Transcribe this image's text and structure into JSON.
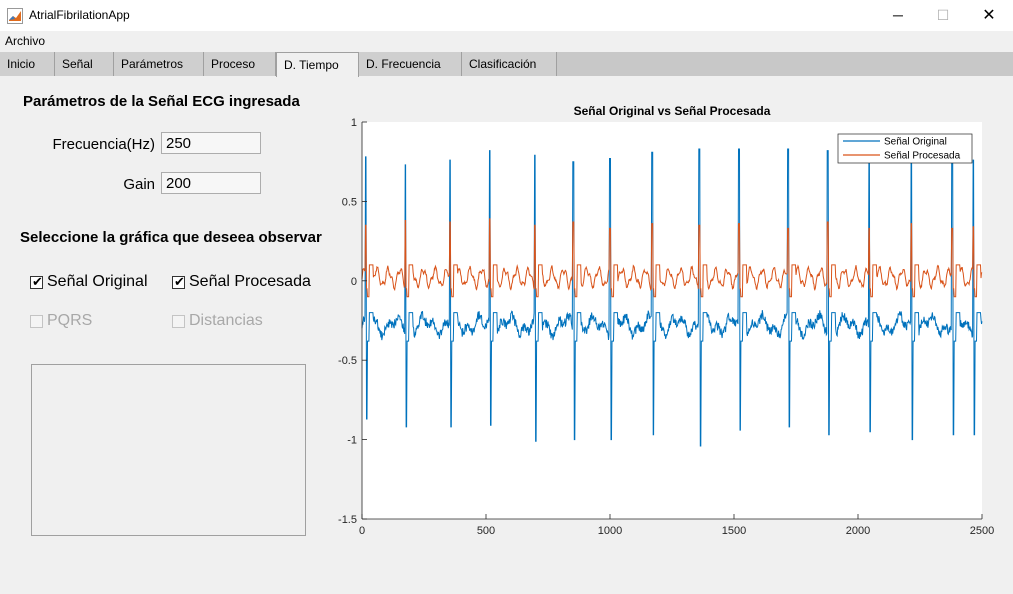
{
  "window": {
    "title": "AtrialFibrilationApp",
    "minimize_glyph": "─",
    "maximize_glyph": "☐",
    "close_glyph": "✕"
  },
  "menubar": {
    "archivo": "Archivo"
  },
  "tabs": [
    {
      "label": "Inicio",
      "active": false
    },
    {
      "label": "Señal",
      "active": false
    },
    {
      "label": "Parámetros",
      "active": false
    },
    {
      "label": "Proceso",
      "active": false
    },
    {
      "label": "D. Tiempo",
      "active": true
    },
    {
      "label": "D. Frecuencia",
      "active": false
    },
    {
      "label": "Clasificación",
      "active": false
    }
  ],
  "params": {
    "heading": "Parámetros de la Señal ECG ingresada",
    "freq_label": "Frecuencia(Hz)",
    "freq_value": "250",
    "gain_label": "Gain",
    "gain_value": "200"
  },
  "select": {
    "heading": "Seleccione la gráfica que deseea observar",
    "original_label": "Señal Original",
    "original_checked": true,
    "procesada_label": "Señal Procesada",
    "procesada_checked": true,
    "pqrs_label": "PQRS",
    "pqrs_enabled": false,
    "distancias_label": "Distancias",
    "distancias_enabled": false,
    "check_glyph": "✔"
  },
  "chart_data": {
    "type": "line",
    "title": "Señal Original vs Señal Procesada",
    "xlabel": "",
    "ylabel": "",
    "xlim": [
      0,
      2500
    ],
    "ylim": [
      -1.5,
      1
    ],
    "xticks": [
      "0",
      "500",
      "1000",
      "1500",
      "2000",
      "2500"
    ],
    "yticks": [
      "-1.5",
      "-1",
      "-0.5",
      "0",
      "0.5",
      "1"
    ],
    "grid": false,
    "legend_position": "top-right",
    "colors": {
      "original": "#0072bd",
      "procesada": "#d95319"
    },
    "beats": {
      "x": [
        15,
        175,
        355,
        515,
        697,
        852,
        1000,
        1170,
        1360,
        1520,
        1718,
        1878,
        2045,
        2215,
        2380,
        2465
      ],
      "original_peak": [
        0.78,
        0.73,
        0.76,
        0.82,
        0.79,
        0.75,
        0.77,
        0.81,
        0.83,
        0.83,
        0.83,
        0.82,
        0.78,
        0.83,
        0.78,
        0.76
      ],
      "original_trough": [
        -0.87,
        -0.92,
        -0.92,
        -0.91,
        -1.01,
        -1.0,
        -1.0,
        -0.97,
        -1.04,
        -0.94,
        -0.92,
        -0.97,
        -0.95,
        -1.0,
        -0.97,
        -0.97
      ],
      "procesada_peak": [
        0.35,
        0.38,
        0.37,
        0.39,
        0.35,
        0.37,
        0.33,
        0.36,
        0.35,
        0.36,
        0.33,
        0.37,
        0.33,
        0.36,
        0.33,
        0.34
      ]
    },
    "original_baseline": -0.28,
    "procesada_baseline": 0.02,
    "series": [
      {
        "name": "Señal Original"
      },
      {
        "name": "Señal Procesada"
      }
    ]
  }
}
